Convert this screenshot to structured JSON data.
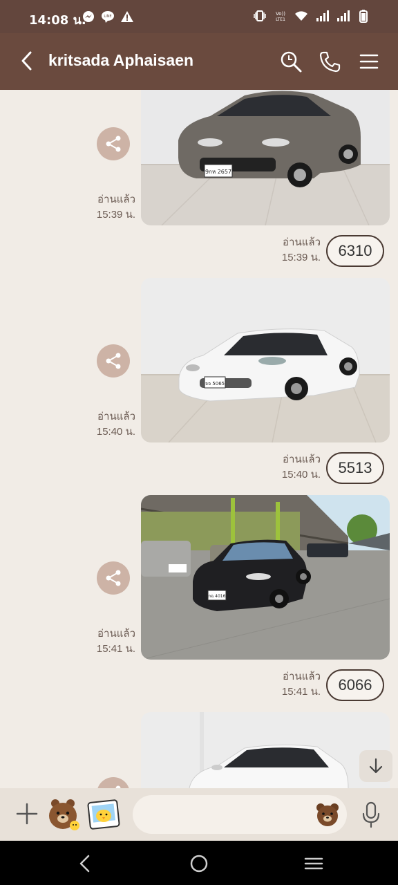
{
  "status": {
    "time": "14:08 น.",
    "left_icons": [
      "messenger-icon",
      "line-icon",
      "warning-icon"
    ],
    "right_icons": [
      "vibrate-icon",
      "volte-icon",
      "wifi-icon",
      "signal-icon",
      "signal-icon",
      "battery-icon"
    ]
  },
  "header": {
    "title": "kritsada Aphaisaen",
    "icons": [
      "back-icon",
      "search-icon",
      "phone-icon",
      "menu-icon"
    ]
  },
  "messages": [
    {
      "read_label": "อ่านแล้ว",
      "time": "15:39 น.",
      "reply_read": "อ่านแล้ว",
      "reply_time": "15:39 น.",
      "reply_text": "6310",
      "car_color": "#6f6a64",
      "plate": "9กห 2657"
    },
    {
      "read_label": "อ่านแล้ว",
      "time": "15:40 น.",
      "reply_read": "อ่านแล้ว",
      "reply_time": "15:40 น.",
      "reply_text": "5513",
      "car_color": "#f6f6f6",
      "plate": "จจ 5065"
    },
    {
      "read_label": "อ่านแล้ว",
      "time": "15:41 น.",
      "reply_read": "อ่านแล้ว",
      "reply_time": "15:41 น.",
      "reply_text": "6066",
      "car_color": "#1f1f22",
      "plate": "กฉ 4016"
    }
  ],
  "input": {
    "placeholder": "",
    "icons": [
      "plus-icon",
      "sticker-brown-icon",
      "sticker-sally-icon",
      "emoji-icon",
      "mic-icon"
    ]
  },
  "colors": {
    "header": "#6a4a3e",
    "status_bar": "#63463d",
    "background": "#f1ece6",
    "share_button": "#cdb3a6"
  }
}
